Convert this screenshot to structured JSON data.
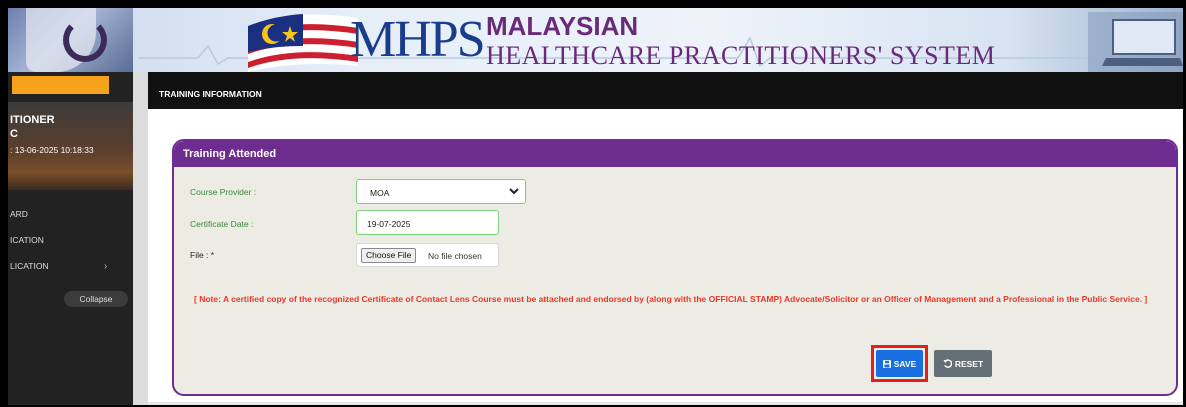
{
  "banner": {
    "logo_text": "MHPS",
    "title_line1": "MALAYSIAN",
    "title_line2": "HEALTHCARE PRACTITIONERS' SYSTEM"
  },
  "sidebar": {
    "user_name": "ITIONER",
    "user_role": "C",
    "login_text": ": 13-06-2025 10:18:33",
    "items": [
      {
        "label": "ARD"
      },
      {
        "label": "ICATION"
      },
      {
        "label": "LICATION",
        "chevron": "›"
      }
    ],
    "collapse_label": "Collapse"
  },
  "header": {
    "title": "TRAINING INFORMATION"
  },
  "panel": {
    "title": "Training Attended",
    "course_provider_label": "Course Provider :",
    "course_provider_value": "MOA",
    "certificate_date_label": "Certificate Date :",
    "certificate_date_value": "19-07-2025",
    "file_label": "File : *",
    "file_button_label": "Choose File",
    "file_status": "No file chosen",
    "note_text": "[ Note: A certified copy of the recognized Certificate of Contact Lens Course must be attached and endorsed by (along with the OFFICIAL STAMP) Advocate/Solicitor or an Officer of Management and a Professional in the Public Service. ]",
    "save_label": "SAVE",
    "reset_label": "RESET"
  },
  "colors": {
    "accent_purple": "#6f2c8f",
    "save_blue": "#1a6fe0",
    "reset_gray": "#656f76",
    "note_red": "#e8392b",
    "highlight_red": "#e2211c",
    "sidebar_orange": "#f7a21b"
  }
}
